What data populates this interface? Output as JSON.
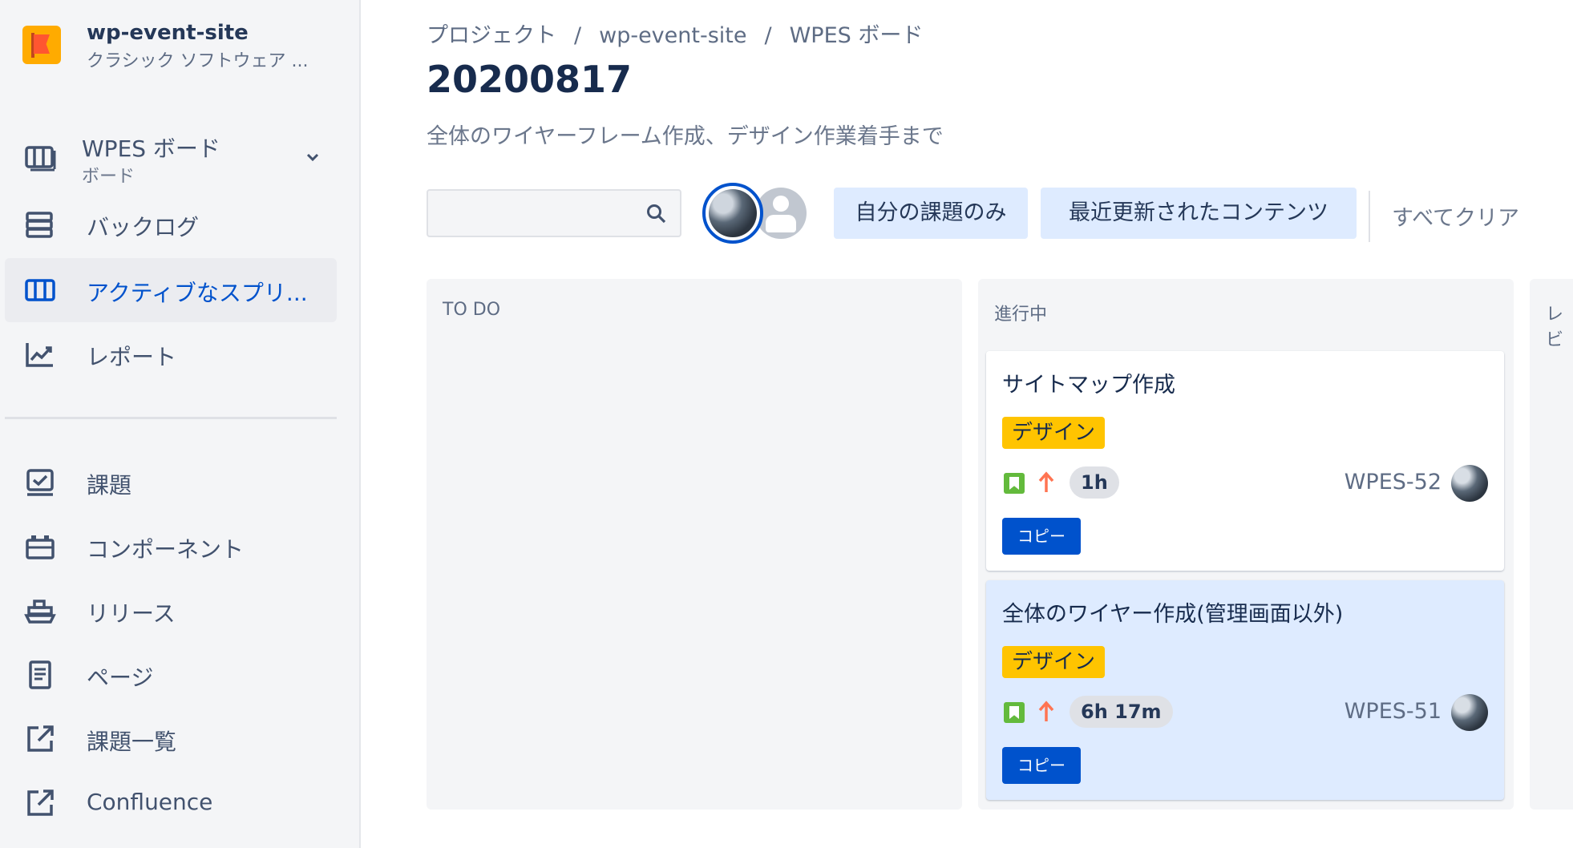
{
  "sidebar": {
    "project_name": "wp-event-site",
    "project_type": "クラシック ソフトウェア ...",
    "board": {
      "title": "WPES ボード",
      "subtitle": "ボード"
    },
    "items": [
      {
        "label": "バックログ"
      },
      {
        "label": "アクティブなスプリ..."
      },
      {
        "label": "レポート"
      },
      {
        "label": "課題"
      },
      {
        "label": "コンポーネント"
      },
      {
        "label": "リリース"
      },
      {
        "label": "ページ"
      },
      {
        "label": "課題一覧"
      },
      {
        "label": "Confluence"
      }
    ]
  },
  "breadcrumb": [
    "プロジェクト",
    "wp-event-site",
    "WPES ボード"
  ],
  "breadcrumb_sep": "/",
  "page": {
    "title": "20200817",
    "goal": "全体のワイヤーフレーム作成、デザイン作業着手まで"
  },
  "filters": {
    "search_value": "",
    "quick": [
      "自分の課題のみ",
      "最近更新されたコンテンツ"
    ],
    "clear": "すべてクリア"
  },
  "columns": [
    {
      "title": "TO DO",
      "cards": []
    },
    {
      "title": "進行中",
      "cards": [
        {
          "summary": "サイトマップ作成",
          "epic": "デザイン",
          "estimate": "1h",
          "key": "WPES-52",
          "action": "コピー"
        },
        {
          "summary": "全体のワイヤー作成(管理画面以外)",
          "epic": "デザイン",
          "estimate": "6h 17m",
          "key": "WPES-51",
          "action": "コピー"
        }
      ]
    },
    {
      "title": "レビ",
      "cards": []
    }
  ],
  "colors": {
    "accent": "#0052cc",
    "epic": "#ffc400",
    "story": "#63ba3c",
    "priority": "#ff7452"
  }
}
